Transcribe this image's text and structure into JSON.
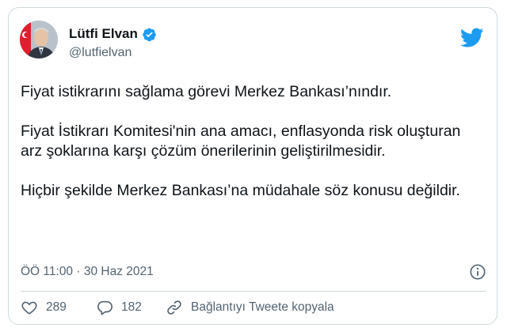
{
  "author": {
    "name": "Lütfi Elvan",
    "handle": "@lutfielvan"
  },
  "tweet": {
    "paragraphs": [
      "Fiyat istikrarını sağlama görevi Merkez Bankası’nındır.",
      "Fiyat İstikrarı Komitesi'nin ana amacı, enflasyonda risk oluşturan arz şoklarına karşı çözüm önerilerinin geliştirilmesidir.",
      "Hiçbir şekilde Merkez Bankası’na müdahale söz konusu değildir."
    ],
    "timestamp": "ÖÖ 11:00 · 30 Haz 2021"
  },
  "actions": {
    "likes": "289",
    "replies": "182",
    "copy_link": "Bağlantıyı Tweete kopyala"
  },
  "colors": {
    "twitter_blue": "#1d9bf0",
    "text": "#0f1419",
    "secondary_text": "#536471",
    "border": "#cfd9de"
  }
}
